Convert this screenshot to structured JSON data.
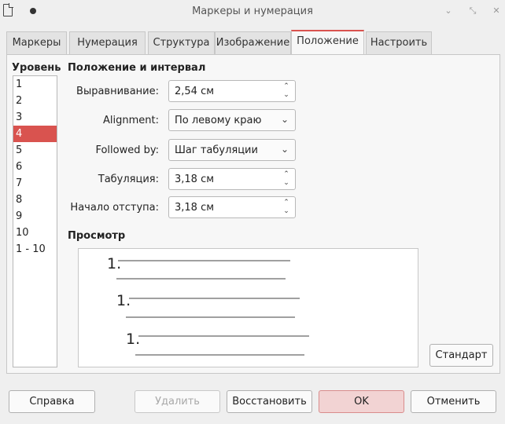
{
  "window": {
    "title": "Маркеры и нумерация"
  },
  "tabs": [
    "Маркеры",
    "Нумерация",
    "Структура",
    "Изображение",
    "Положение",
    "Настроить"
  ],
  "active_tab": "Положение",
  "levels": {
    "label": "Уровень",
    "items": [
      "1",
      "2",
      "3",
      "4",
      "5",
      "6",
      "7",
      "8",
      "9",
      "10",
      "1 - 10"
    ],
    "selected": "4"
  },
  "position": {
    "section_title": "Положение и интервал",
    "alignment_offset": {
      "label": "Выравнивание:",
      "value": "2,54 см"
    },
    "alignment": {
      "label": "Alignment:",
      "value": "По левому краю"
    },
    "followed_by": {
      "label": "Followed by:",
      "value": "Шаг табуляции"
    },
    "tab_stop": {
      "label": "Табуляция:",
      "value": "3,18 см"
    },
    "indent": {
      "label": "Начало отступа:",
      "value": "3,18 см"
    }
  },
  "preview": {
    "title": "Просмотр",
    "numbers": [
      "1.",
      "1.",
      "1."
    ]
  },
  "buttons": {
    "default": "Стандарт",
    "help": "Справка",
    "delete": "Удалить",
    "reset": "Восстановить",
    "ok": "OK",
    "cancel": "Отменить"
  },
  "colors": {
    "accent": "#d9534f",
    "ok_bg": "#f2d3d3"
  },
  "icons": [
    "document-icon",
    "pin-icon",
    "minimize-icon",
    "restore-icon",
    "close-icon"
  ]
}
